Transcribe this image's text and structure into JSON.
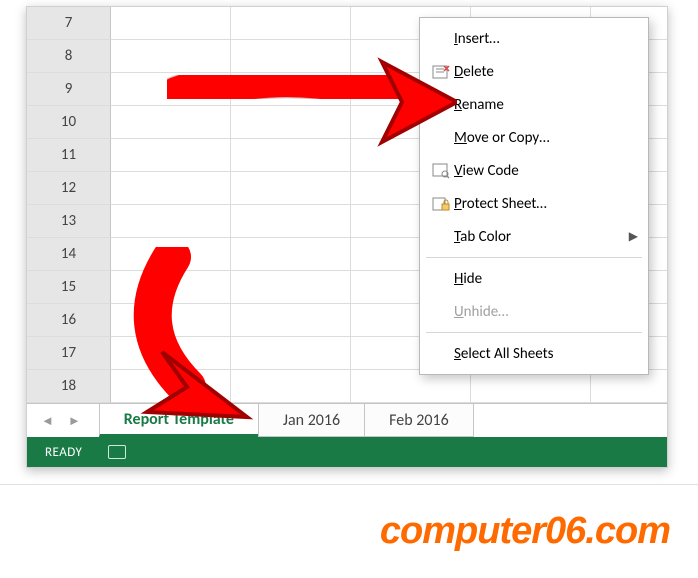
{
  "grid": {
    "row_headers": [
      "7",
      "8",
      "9",
      "10",
      "11",
      "12",
      "13",
      "14",
      "15",
      "16",
      "17",
      "18"
    ]
  },
  "tabs": {
    "active": "Report Template",
    "inactive": [
      "Jan 2016",
      "Feb 2016"
    ]
  },
  "status": {
    "ready": "READY"
  },
  "ctx": {
    "insert": "Insert…",
    "delete": "Delete",
    "rename": "Rename",
    "move_copy": "Move or Copy…",
    "view_code": "View Code",
    "protect": "Protect Sheet…",
    "tab_color": "Tab Color",
    "hide": "Hide",
    "unhide": "Unhide…",
    "select_all": "Select All Sheets"
  },
  "watermark": "computer06.com"
}
